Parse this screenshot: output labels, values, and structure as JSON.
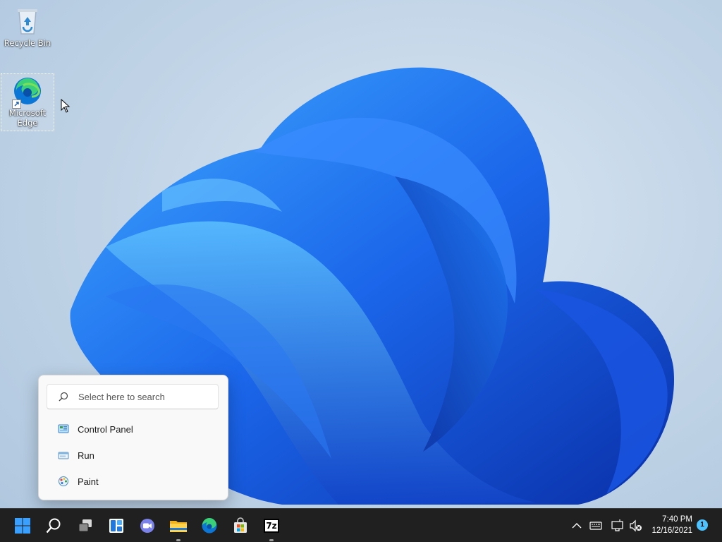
{
  "desktop": {
    "icons": [
      {
        "label": "Recycle Bin"
      },
      {
        "label": "Microsoft Edge"
      }
    ]
  },
  "search_popup": {
    "placeholder": "Select here to search",
    "items": [
      {
        "label": "Control Panel",
        "icon": "control-panel-icon"
      },
      {
        "label": "Run",
        "icon": "run-icon"
      },
      {
        "label": "Paint",
        "icon": "paint-icon"
      }
    ]
  },
  "taskbar": {
    "apps": [
      {
        "name": "start",
        "icon": "windows-logo-icon"
      },
      {
        "name": "search",
        "icon": "search-icon"
      },
      {
        "name": "task-view",
        "icon": "task-view-icon"
      },
      {
        "name": "widgets",
        "icon": "widgets-icon"
      },
      {
        "name": "teams-chat",
        "icon": "chat-icon"
      },
      {
        "name": "file-explorer",
        "icon": "folder-icon"
      },
      {
        "name": "edge",
        "icon": "edge-icon"
      },
      {
        "name": "store",
        "icon": "store-icon"
      },
      {
        "name": "7-zip",
        "icon": "7zip-icon",
        "label": "7z"
      }
    ],
    "clock": {
      "time": "7:40 PM",
      "date": "12/16/2021"
    },
    "notification_count": "1"
  },
  "colors": {
    "accent": "#0067c0",
    "taskbar": "#202020",
    "bloom": "#1a5fe0"
  }
}
